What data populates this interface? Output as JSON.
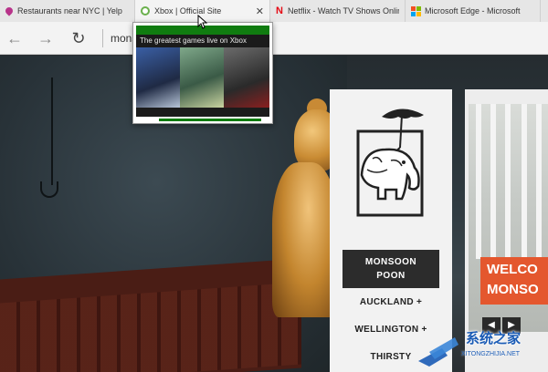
{
  "tabs": [
    {
      "title": "Restaurants near NYC | Yelp",
      "icon": "map-pin-icon",
      "active": false
    },
    {
      "title": "Xbox | Official Site",
      "icon": "xbox-icon",
      "active": true,
      "close": "✕"
    },
    {
      "title": "Netflix - Watch TV Shows Online",
      "icon": "netflix-icon",
      "active": false
    },
    {
      "title": "Microsoft Edge - Microsoft",
      "icon": "microsoft-icon",
      "active": false
    }
  ],
  "navbar": {
    "back": "←",
    "forward": "→",
    "refresh": "↻",
    "address": "mons"
  },
  "preview": {
    "headline": "The greatest games live on Xbox"
  },
  "menu": {
    "primary_button": [
      "MONSOON",
      "POON"
    ],
    "links": [
      "AUCKLAND +",
      "WELLINGTON +",
      "THIRSTY"
    ]
  },
  "photo_card": {
    "welcome": [
      "WELCO",
      "MONSO"
    ],
    "prev": "◀",
    "next": "▶"
  },
  "watermark": {
    "text": "系统之家",
    "url": "XITONGZHIJIA.NET"
  },
  "colors": {
    "xbox_green": "#107c10",
    "welcome_orange": "#e4572e",
    "menu_dark": "#2c2c2c"
  }
}
